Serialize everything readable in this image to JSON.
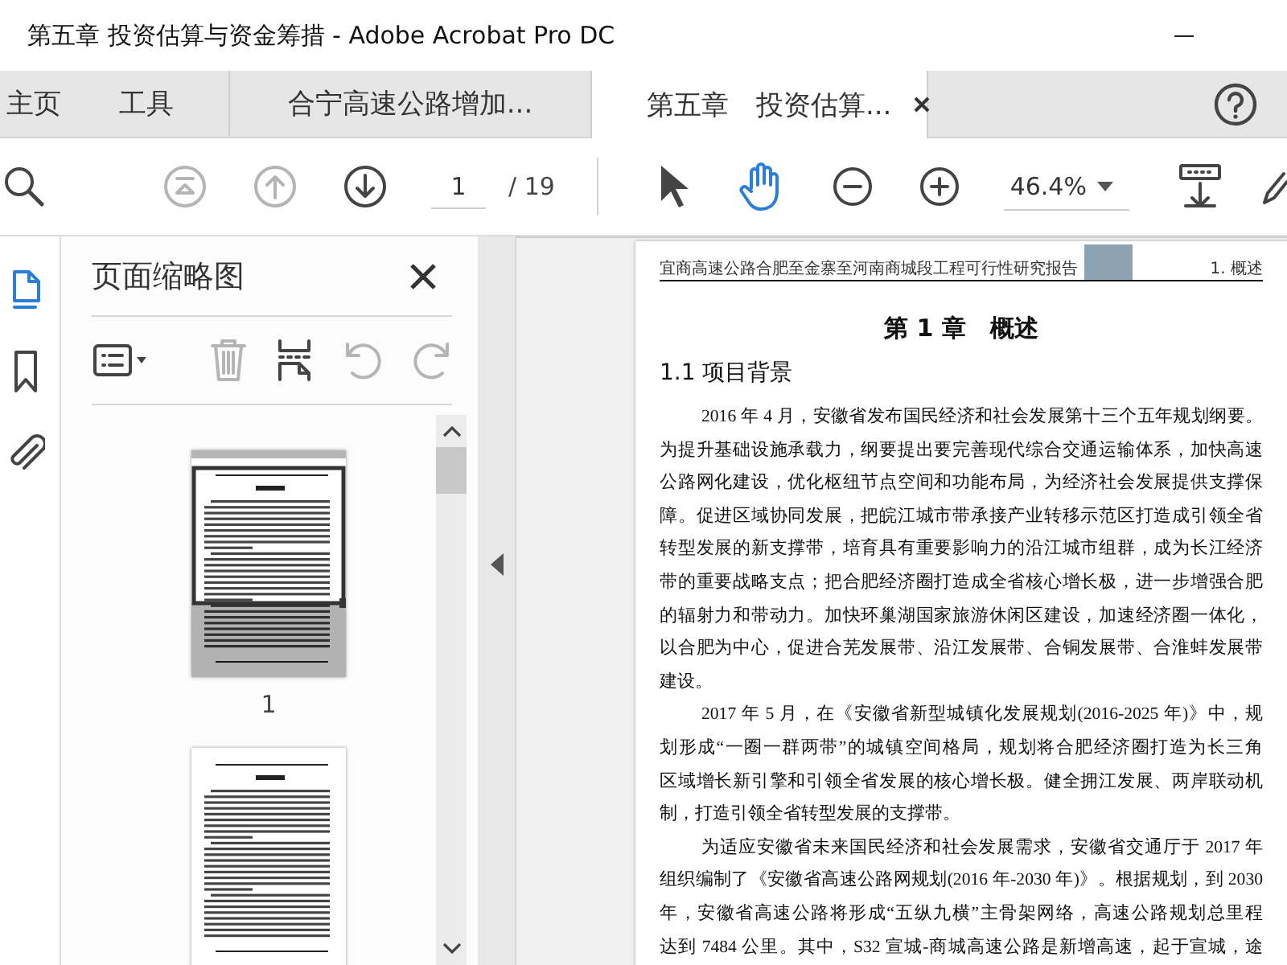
{
  "window": {
    "title": "第五章 投资估算与资金筹措 - Adobe Acrobat Pro DC"
  },
  "tabs": [
    {
      "label": "主页",
      "kind": "nav",
      "selected": false
    },
    {
      "label": "工具",
      "kind": "nav",
      "selected": false
    },
    {
      "label": "合宁高速公路增加...",
      "kind": "doc",
      "selected": false
    },
    {
      "label": "第五章　投资估算...",
      "kind": "doc",
      "selected": true
    }
  ],
  "toolbar": {
    "nav_buttons": [
      {
        "kind": "search",
        "disabled": false
      },
      {
        "kind": "first",
        "disabled": true
      },
      {
        "kind": "previous",
        "disabled": true
      },
      {
        "kind": "next",
        "disabled": false
      }
    ],
    "page_field": {
      "value": "1"
    },
    "page_count": "/ 19",
    "pointer_tools": [
      {
        "kind": "select",
        "selected": false
      },
      {
        "kind": "hand",
        "selected": true
      }
    ],
    "zoom_buttons": [
      {
        "kind": "out"
      },
      {
        "kind": "in"
      }
    ],
    "zoom_field": {
      "value": "46.4%"
    },
    "extra_buttons": [
      {
        "kind": "read"
      },
      {
        "kind": "sign"
      }
    ]
  },
  "nav_rail": [
    {
      "kind": "thumbnails",
      "selected": true
    },
    {
      "kind": "bookmarks",
      "selected": false
    },
    {
      "kind": "attachments",
      "selected": false
    }
  ],
  "thumbnails_panel": {
    "title": "页面缩略图",
    "tools": [
      {
        "kind": "options",
        "disabled": false
      },
      {
        "kind": "delete",
        "disabled": true
      },
      {
        "kind": "insert",
        "disabled": false
      },
      {
        "kind": "rotate-left",
        "disabled": true
      },
      {
        "kind": "rotate-right",
        "disabled": true
      }
    ],
    "pages": [
      {
        "label": "1",
        "selected": true
      },
      {
        "selected": false
      }
    ]
  },
  "document": {
    "header_left": "宜商高速公路合肥至金寨至河南商城段工程可行性研究报告",
    "header_right": "1. 概述",
    "title": "第 1 章　概述",
    "section": "1.1 项目背景",
    "paragraphs": [
      {
        "lines": [
          "2016 年 4 月，安徽省发布国民经济和社会发展第十三个五年规划纲要。",
          "为提升基础设施承载力，纲要提出要完善现代综合交通运输体系，加快高速",
          "公路网化建设，优化枢纽节点空间和功能布局，为经济社会发展提供支撑保",
          "障。促进区域协同发展，把皖江城市带承接产业转移示范区打造成引领全省",
          "转型发展的新支撑带，培育具有重要影响力的沿江城市组群，成为长江经济",
          "带的重要战略支点；把合肥经济圈打造成全省核心增长极，进一步增强合肥",
          "的辐射力和带动力。加快环巢湖国家旅游休闲区建设，加速经济圈一体化，",
          "以合肥为中心，促进合芜发展带、沿江发展带、合铜发展带、合淮蚌发展带",
          "建设。"
        ]
      },
      {
        "lines": [
          "2017 年 5 月，在《安徽省新型城镇化发展规划(2016-2025 年)》中，规",
          "划形成“一圈一群两带”的城镇空间格局，规划将合肥经济圈打造为长三角",
          "区域增长新引擎和引领全省发展的核心增长极。健全拥江发展、两岸联动机",
          "制，打造引领全省转型发展的支撑带。"
        ]
      },
      {
        "lines": [
          "为适应安徽省未来国民经济和社会发展需求，安徽省交通厅于 2017 年",
          "组织编制了《安徽省高速公路网规划(2016 年-2030 年)》。根据规划，到 2030",
          "年，安徽省高速公路将形成“五纵九横”主骨架网络，高速公路规划总里程",
          "达到 7484 公里。其中，S32 宣城-商城高速公路是新增高速，起于宣城，途"
        ]
      }
    ]
  }
}
